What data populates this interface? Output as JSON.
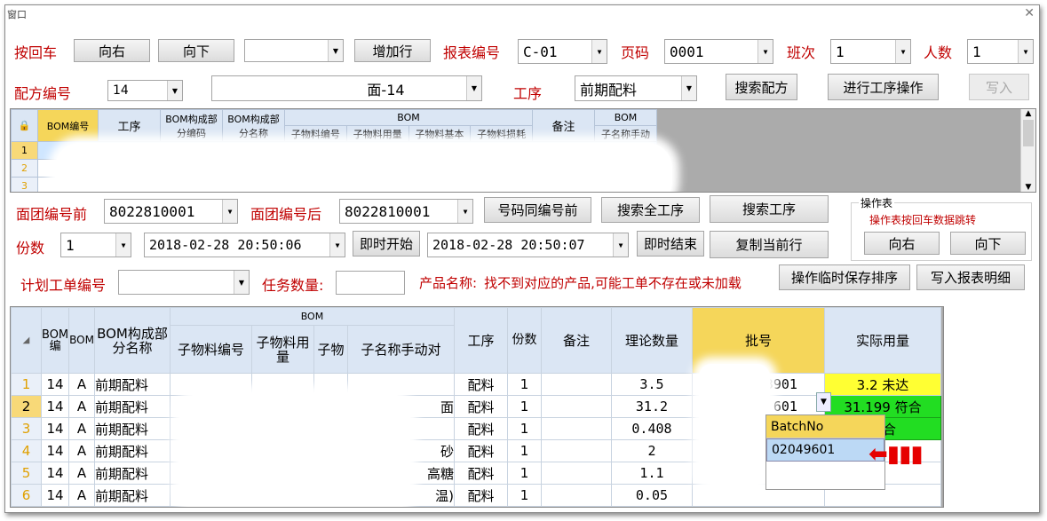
{
  "window": {
    "title": "窗口"
  },
  "row1": {
    "enter_key_label": "按回车",
    "right_btn": "向右",
    "down_btn": "向下",
    "combo_value": "",
    "add_row_btn": "增加行",
    "report_no_label": "报表编号",
    "report_no": "C-01",
    "page_label": "页码",
    "page": "0001",
    "shift_label": "班次",
    "shift": "1",
    "people_label": "人数",
    "people": "1"
  },
  "row2": {
    "formula_no_label": "配方编号",
    "formula_no": "14",
    "formula_name": "面-14",
    "process_label": "工序",
    "process": "前期配料",
    "search_formula_btn": "搜索配方",
    "process_op_btn": "进行工序操作",
    "write_btn": "写入"
  },
  "grid_top": {
    "headers": {
      "bom_no": "BOM编号",
      "process": "工序",
      "part_code": "BOM构成部分编码",
      "part_name": "BOM构成部分名称",
      "bom": "BOM",
      "child_no": "子物料编号",
      "child_qty": "子物料用量",
      "child_base": "子物料基本",
      "child_loss": "子物料损耗",
      "remark": "备注",
      "bom2": "BOM",
      "child_name_manual": "子名称手动"
    },
    "row_numbers": [
      "1",
      "2",
      "3"
    ]
  },
  "row3": {
    "dough_before_label": "面团编号前",
    "dough_before": "8022810001",
    "dough_after_label": "面团编号后",
    "dough_after": "8022810001",
    "same_no_btn": "号码同编号前",
    "search_all_btn": "搜索全工序",
    "search_process_btn": "搜索工序"
  },
  "row4": {
    "portions_label": "份数",
    "portions": "1",
    "start_time": "2018-02-28 20:50:06",
    "start_btn": "即时开始",
    "end_time": "2018-02-28 20:50:07",
    "end_btn": "即时结束",
    "copy_row_btn": "复制当前行"
  },
  "optable": {
    "title": "操作表",
    "hint": "操作表按回车数据跳转",
    "right_btn": "向右",
    "down_btn": "向下"
  },
  "row5": {
    "plan_label": "计划工单编号",
    "task_qty_label": "任务数量:",
    "product_label": "产品名称:",
    "product_msg": "找不到对应的产品,可能工单不存在或未加载",
    "temp_save_btn": "操作临时保存排序",
    "write_detail_btn": "写入报表明细"
  },
  "grid_bottom": {
    "headers": {
      "bom_no": "BOM编",
      "b": "BOM",
      "part_name": "BOM构成部分名称",
      "bom": "BOM",
      "child_no": "子物料编号",
      "child_qty": "子物料用量",
      "child": "子物",
      "child_name": "子名称手动对",
      "process": "工序",
      "portions": "份数",
      "remark": "备注",
      "theory_qty": "理论数量",
      "batch": "批号",
      "actual_qty": "实际用量"
    },
    "rows": [
      {
        "num": "1",
        "bom": "14",
        "b": "A",
        "part": "前期配料",
        "name_tail": "",
        "process": "配料",
        "portions": "1",
        "theory": "3.5",
        "batch": "3901",
        "actual": "3.2 未达",
        "status": "warn"
      },
      {
        "num": "2",
        "bom": "14",
        "b": "A",
        "part": "前期配料",
        "name_tail": "面",
        "process": "配料",
        "portions": "1",
        "theory": "31.2",
        "batch": "601",
        "actual": "31.199 符合",
        "status": "ok"
      },
      {
        "num": "3",
        "bom": "14",
        "b": "A",
        "part": "前期配料",
        "name_tail": "",
        "process": "配料",
        "portions": "1",
        "theory": "0.408",
        "batch": "",
        "actual": "符合",
        "status": "ok"
      },
      {
        "num": "4",
        "bom": "14",
        "b": "A",
        "part": "前期配料",
        "name_tail": "砂",
        "process": "配料",
        "portions": "1",
        "theory": "2",
        "batch": "",
        "actual": "",
        "status": ""
      },
      {
        "num": "5",
        "bom": "14",
        "b": "A",
        "part": "前期配料",
        "name_tail": "高糖",
        "process": "配料",
        "portions": "1",
        "theory": "1.1",
        "batch": "",
        "actual": "",
        "status": ""
      },
      {
        "num": "6",
        "bom": "14",
        "b": "A",
        "part": "前期配料",
        "name_tail": "温)",
        "process": "配料",
        "portions": "1",
        "theory": "0.05",
        "batch": "",
        "actual": "",
        "status": ""
      }
    ],
    "dropdown": {
      "header": "BatchNo",
      "item": "02049601"
    }
  },
  "colors": {
    "label_red": "#c00000",
    "ok_green": "#22dd22",
    "warn_yellow": "#ffff33",
    "header_yellow": "#f5d65a",
    "arrow_red": "#e60000"
  }
}
